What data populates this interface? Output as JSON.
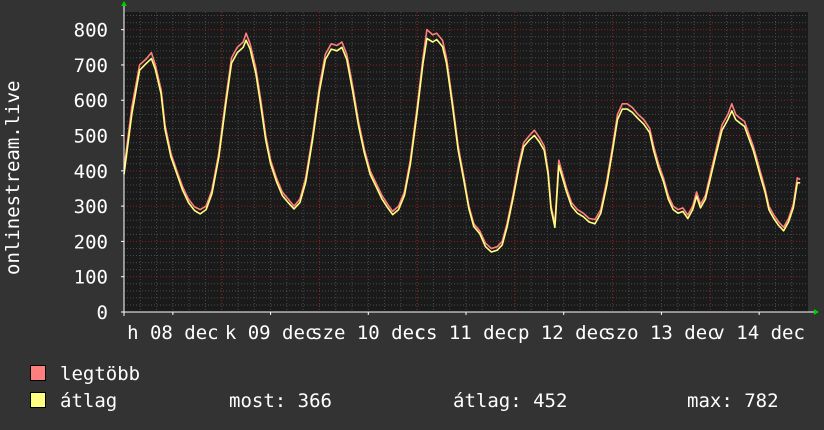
{
  "chart_data": {
    "type": "line",
    "ylabel": "onlinestream.live",
    "ylim": [
      0,
      850
    ],
    "yticks": [
      0,
      100,
      200,
      300,
      400,
      500,
      600,
      700,
      800
    ],
    "grid": true,
    "xticks": [
      {
        "label": "h 08 dec",
        "day": 0.5
      },
      {
        "label": "k 09 dec",
        "day": 1.5
      },
      {
        "label": "sze 10 dec",
        "day": 2.5
      },
      {
        "label": "cs 11 dec",
        "day": 3.5
      },
      {
        "label": "p 12 dec",
        "day": 4.5
      },
      {
        "label": "szo 13 dec",
        "day": 5.5
      },
      {
        "label": "v 14 dec",
        "day": 6.5
      }
    ],
    "xrange_days": [
      0,
      7
    ],
    "series": [
      {
        "name": "legtöbb",
        "color": "#ff7f7f",
        "points": [
          [
            0.0,
            405
          ],
          [
            0.08,
            580
          ],
          [
            0.16,
            700
          ],
          [
            0.23,
            718
          ],
          [
            0.28,
            735
          ],
          [
            0.32,
            700
          ],
          [
            0.38,
            630
          ],
          [
            0.42,
            530
          ],
          [
            0.48,
            450
          ],
          [
            0.54,
            400
          ],
          [
            0.6,
            355
          ],
          [
            0.66,
            320
          ],
          [
            0.72,
            298
          ],
          [
            0.78,
            290
          ],
          [
            0.84,
            300
          ],
          [
            0.9,
            345
          ],
          [
            0.97,
            450
          ],
          [
            1.04,
            600
          ],
          [
            1.1,
            720
          ],
          [
            1.16,
            750
          ],
          [
            1.22,
            765
          ],
          [
            1.25,
            790
          ],
          [
            1.29,
            760
          ],
          [
            1.35,
            690
          ],
          [
            1.4,
            600
          ],
          [
            1.45,
            500
          ],
          [
            1.5,
            430
          ],
          [
            1.56,
            380
          ],
          [
            1.62,
            340
          ],
          [
            1.68,
            320
          ],
          [
            1.74,
            300
          ],
          [
            1.8,
            320
          ],
          [
            1.86,
            380
          ],
          [
            1.93,
            500
          ],
          [
            2.0,
            640
          ],
          [
            2.06,
            730
          ],
          [
            2.12,
            760
          ],
          [
            2.18,
            755
          ],
          [
            2.23,
            765
          ],
          [
            2.28,
            730
          ],
          [
            2.34,
            640
          ],
          [
            2.4,
            540
          ],
          [
            2.46,
            460
          ],
          [
            2.52,
            400
          ],
          [
            2.58,
            365
          ],
          [
            2.64,
            330
          ],
          [
            2.7,
            305
          ],
          [
            2.75,
            285
          ],
          [
            2.81,
            300
          ],
          [
            2.87,
            340
          ],
          [
            2.93,
            430
          ],
          [
            3.0,
            580
          ],
          [
            3.06,
            720
          ],
          [
            3.1,
            800
          ],
          [
            3.16,
            785
          ],
          [
            3.2,
            790
          ],
          [
            3.26,
            770
          ],
          [
            3.3,
            720
          ],
          [
            3.36,
            600
          ],
          [
            3.42,
            470
          ],
          [
            3.48,
            380
          ],
          [
            3.53,
            300
          ],
          [
            3.58,
            250
          ],
          [
            3.64,
            230
          ],
          [
            3.7,
            195
          ],
          [
            3.76,
            180
          ],
          [
            3.82,
            185
          ],
          [
            3.87,
            200
          ],
          [
            3.92,
            250
          ],
          [
            3.98,
            330
          ],
          [
            4.04,
            420
          ],
          [
            4.09,
            480
          ],
          [
            4.15,
            500
          ],
          [
            4.2,
            515
          ],
          [
            4.25,
            495
          ],
          [
            4.3,
            470
          ],
          [
            4.34,
            400
          ],
          [
            4.37,
            300
          ],
          [
            4.41,
            250
          ],
          [
            4.45,
            430
          ],
          [
            4.49,
            390
          ],
          [
            4.53,
            350
          ],
          [
            4.58,
            310
          ],
          [
            4.64,
            290
          ],
          [
            4.7,
            280
          ],
          [
            4.76,
            265
          ],
          [
            4.82,
            262
          ],
          [
            4.88,
            290
          ],
          [
            4.94,
            370
          ],
          [
            5.0,
            470
          ],
          [
            5.05,
            560
          ],
          [
            5.1,
            590
          ],
          [
            5.15,
            590
          ],
          [
            5.2,
            580
          ],
          [
            5.26,
            560
          ],
          [
            5.32,
            545
          ],
          [
            5.38,
            520
          ],
          [
            5.42,
            470
          ],
          [
            5.47,
            420
          ],
          [
            5.52,
            380
          ],
          [
            5.57,
            330
          ],
          [
            5.62,
            300
          ],
          [
            5.67,
            290
          ],
          [
            5.72,
            295
          ],
          [
            5.77,
            275
          ],
          [
            5.82,
            300
          ],
          [
            5.86,
            340
          ],
          [
            5.9,
            305
          ],
          [
            5.95,
            330
          ],
          [
            6.0,
            390
          ],
          [
            6.06,
            460
          ],
          [
            6.12,
            530
          ],
          [
            6.18,
            560
          ],
          [
            6.22,
            590
          ],
          [
            6.26,
            560
          ],
          [
            6.3,
            550
          ],
          [
            6.35,
            540
          ],
          [
            6.4,
            500
          ],
          [
            6.44,
            470
          ],
          [
            6.48,
            430
          ],
          [
            6.52,
            390
          ],
          [
            6.56,
            350
          ],
          [
            6.6,
            300
          ],
          [
            6.65,
            275
          ],
          [
            6.7,
            255
          ],
          [
            6.75,
            240
          ],
          [
            6.8,
            265
          ],
          [
            6.85,
            305
          ],
          [
            6.89,
            380
          ],
          [
            6.92,
            375
          ]
        ]
      },
      {
        "name": "átlag",
        "color": "#ffff80",
        "points": [
          [
            0.0,
            390
          ],
          [
            0.08,
            560
          ],
          [
            0.16,
            685
          ],
          [
            0.23,
            705
          ],
          [
            0.28,
            718
          ],
          [
            0.32,
            688
          ],
          [
            0.38,
            618
          ],
          [
            0.42,
            518
          ],
          [
            0.48,
            440
          ],
          [
            0.54,
            392
          ],
          [
            0.6,
            345
          ],
          [
            0.66,
            310
          ],
          [
            0.72,
            288
          ],
          [
            0.78,
            278
          ],
          [
            0.84,
            290
          ],
          [
            0.9,
            335
          ],
          [
            0.97,
            438
          ],
          [
            1.04,
            585
          ],
          [
            1.1,
            705
          ],
          [
            1.16,
            735
          ],
          [
            1.22,
            750
          ],
          [
            1.25,
            770
          ],
          [
            1.29,
            745
          ],
          [
            1.35,
            675
          ],
          [
            1.4,
            585
          ],
          [
            1.45,
            488
          ],
          [
            1.5,
            420
          ],
          [
            1.56,
            370
          ],
          [
            1.62,
            330
          ],
          [
            1.68,
            310
          ],
          [
            1.74,
            292
          ],
          [
            1.8,
            310
          ],
          [
            1.86,
            368
          ],
          [
            1.93,
            488
          ],
          [
            2.0,
            625
          ],
          [
            2.06,
            715
          ],
          [
            2.12,
            745
          ],
          [
            2.18,
            740
          ],
          [
            2.23,
            750
          ],
          [
            2.28,
            715
          ],
          [
            2.34,
            625
          ],
          [
            2.4,
            528
          ],
          [
            2.46,
            450
          ],
          [
            2.52,
            390
          ],
          [
            2.58,
            355
          ],
          [
            2.64,
            320
          ],
          [
            2.7,
            295
          ],
          [
            2.75,
            276
          ],
          [
            2.81,
            290
          ],
          [
            2.87,
            330
          ],
          [
            2.93,
            418
          ],
          [
            3.0,
            565
          ],
          [
            3.06,
            705
          ],
          [
            3.1,
            775
          ],
          [
            3.16,
            765
          ],
          [
            3.2,
            772
          ],
          [
            3.26,
            752
          ],
          [
            3.3,
            705
          ],
          [
            3.36,
            588
          ],
          [
            3.42,
            458
          ],
          [
            3.48,
            370
          ],
          [
            3.53,
            292
          ],
          [
            3.58,
            242
          ],
          [
            3.64,
            222
          ],
          [
            3.7,
            185
          ],
          [
            3.76,
            170
          ],
          [
            3.82,
            175
          ],
          [
            3.87,
            190
          ],
          [
            3.92,
            240
          ],
          [
            3.98,
            320
          ],
          [
            4.04,
            408
          ],
          [
            4.09,
            468
          ],
          [
            4.15,
            488
          ],
          [
            4.2,
            500
          ],
          [
            4.25,
            482
          ],
          [
            4.3,
            458
          ],
          [
            4.34,
            390
          ],
          [
            4.37,
            292
          ],
          [
            4.41,
            240
          ],
          [
            4.45,
            415
          ],
          [
            4.49,
            378
          ],
          [
            4.53,
            340
          ],
          [
            4.58,
            300
          ],
          [
            4.64,
            280
          ],
          [
            4.7,
            270
          ],
          [
            4.76,
            255
          ],
          [
            4.82,
            250
          ],
          [
            4.88,
            280
          ],
          [
            4.94,
            358
          ],
          [
            5.0,
            458
          ],
          [
            5.05,
            545
          ],
          [
            5.1,
            575
          ],
          [
            5.15,
            575
          ],
          [
            5.2,
            566
          ],
          [
            5.26,
            548
          ],
          [
            5.32,
            532
          ],
          [
            5.38,
            508
          ],
          [
            5.42,
            458
          ],
          [
            5.47,
            408
          ],
          [
            5.52,
            370
          ],
          [
            5.57,
            320
          ],
          [
            5.62,
            290
          ],
          [
            5.67,
            280
          ],
          [
            5.72,
            285
          ],
          [
            5.77,
            265
          ],
          [
            5.82,
            290
          ],
          [
            5.86,
            328
          ],
          [
            5.9,
            295
          ],
          [
            5.95,
            320
          ],
          [
            6.0,
            378
          ],
          [
            6.06,
            448
          ],
          [
            6.12,
            515
          ],
          [
            6.18,
            545
          ],
          [
            6.22,
            570
          ],
          [
            6.26,
            545
          ],
          [
            6.3,
            536
          ],
          [
            6.35,
            526
          ],
          [
            6.4,
            488
          ],
          [
            6.44,
            458
          ],
          [
            6.48,
            418
          ],
          [
            6.52,
            378
          ],
          [
            6.56,
            340
          ],
          [
            6.6,
            290
          ],
          [
            6.65,
            265
          ],
          [
            6.7,
            245
          ],
          [
            6.75,
            230
          ],
          [
            6.8,
            255
          ],
          [
            6.85,
            295
          ],
          [
            6.89,
            366
          ],
          [
            6.92,
            366
          ]
        ]
      }
    ],
    "stats": {
      "most_label": "most:",
      "most_value": "366",
      "atlag_label": "átlag:",
      "atlag_value": "452",
      "max_label": "max:",
      "max_value": "782"
    }
  },
  "colors": {
    "background": "#333333",
    "plot_background": "#1a1a1a",
    "grid": "#4a4a4a",
    "major_grid": "#8b2020",
    "axis": "#ffffff",
    "arrow": "#00cc00"
  }
}
